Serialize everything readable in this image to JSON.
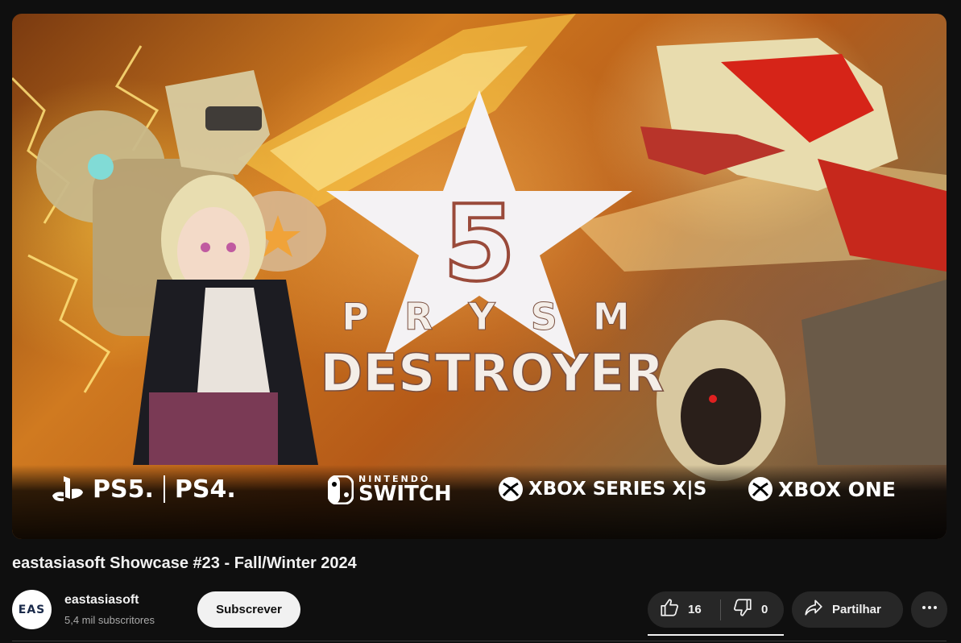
{
  "video": {
    "title": "eastasiasoft Showcase #23 - Fall/Winter 2024",
    "thumbnail": {
      "game_number": "5",
      "game_word_1": "P R Y S M",
      "game_word_2": "DESTROYER",
      "platforms": [
        {
          "name": "PS5",
          "label": "PS5.",
          "icon": "playstation-icon"
        },
        {
          "name": "PS4",
          "label": "PS4.",
          "icon": ""
        },
        {
          "name": "Nintendo Switch",
          "label_small": "NINTENDO",
          "label_big": "SWITCH",
          "icon": "switch-icon"
        },
        {
          "name": "Xbox Series X|S",
          "label": "XBOX SERIES X|S",
          "icon": "xbox-icon"
        },
        {
          "name": "Xbox One",
          "label": "XBOX ONE",
          "icon": "xbox-icon"
        }
      ]
    }
  },
  "channel": {
    "name": "eastasiasoft",
    "subscribers": "5,4 mil subscritores",
    "avatar_text": "EAS",
    "subscribe_label": "Subscrever"
  },
  "actions": {
    "likes": "16",
    "dislikes": "0",
    "share_label": "Partilhar",
    "like_icon": "thumbs-up-icon",
    "dislike_icon": "thumbs-down-icon",
    "share_icon": "share-arrow-icon",
    "more_icon": "more-dots-icon"
  },
  "colors": {
    "background": "#0f0f0f",
    "button_bg": "#272727",
    "subscribe_bg": "#f1f1f1",
    "text": "#f1f1f1",
    "muted_text": "#aaaaaa"
  }
}
